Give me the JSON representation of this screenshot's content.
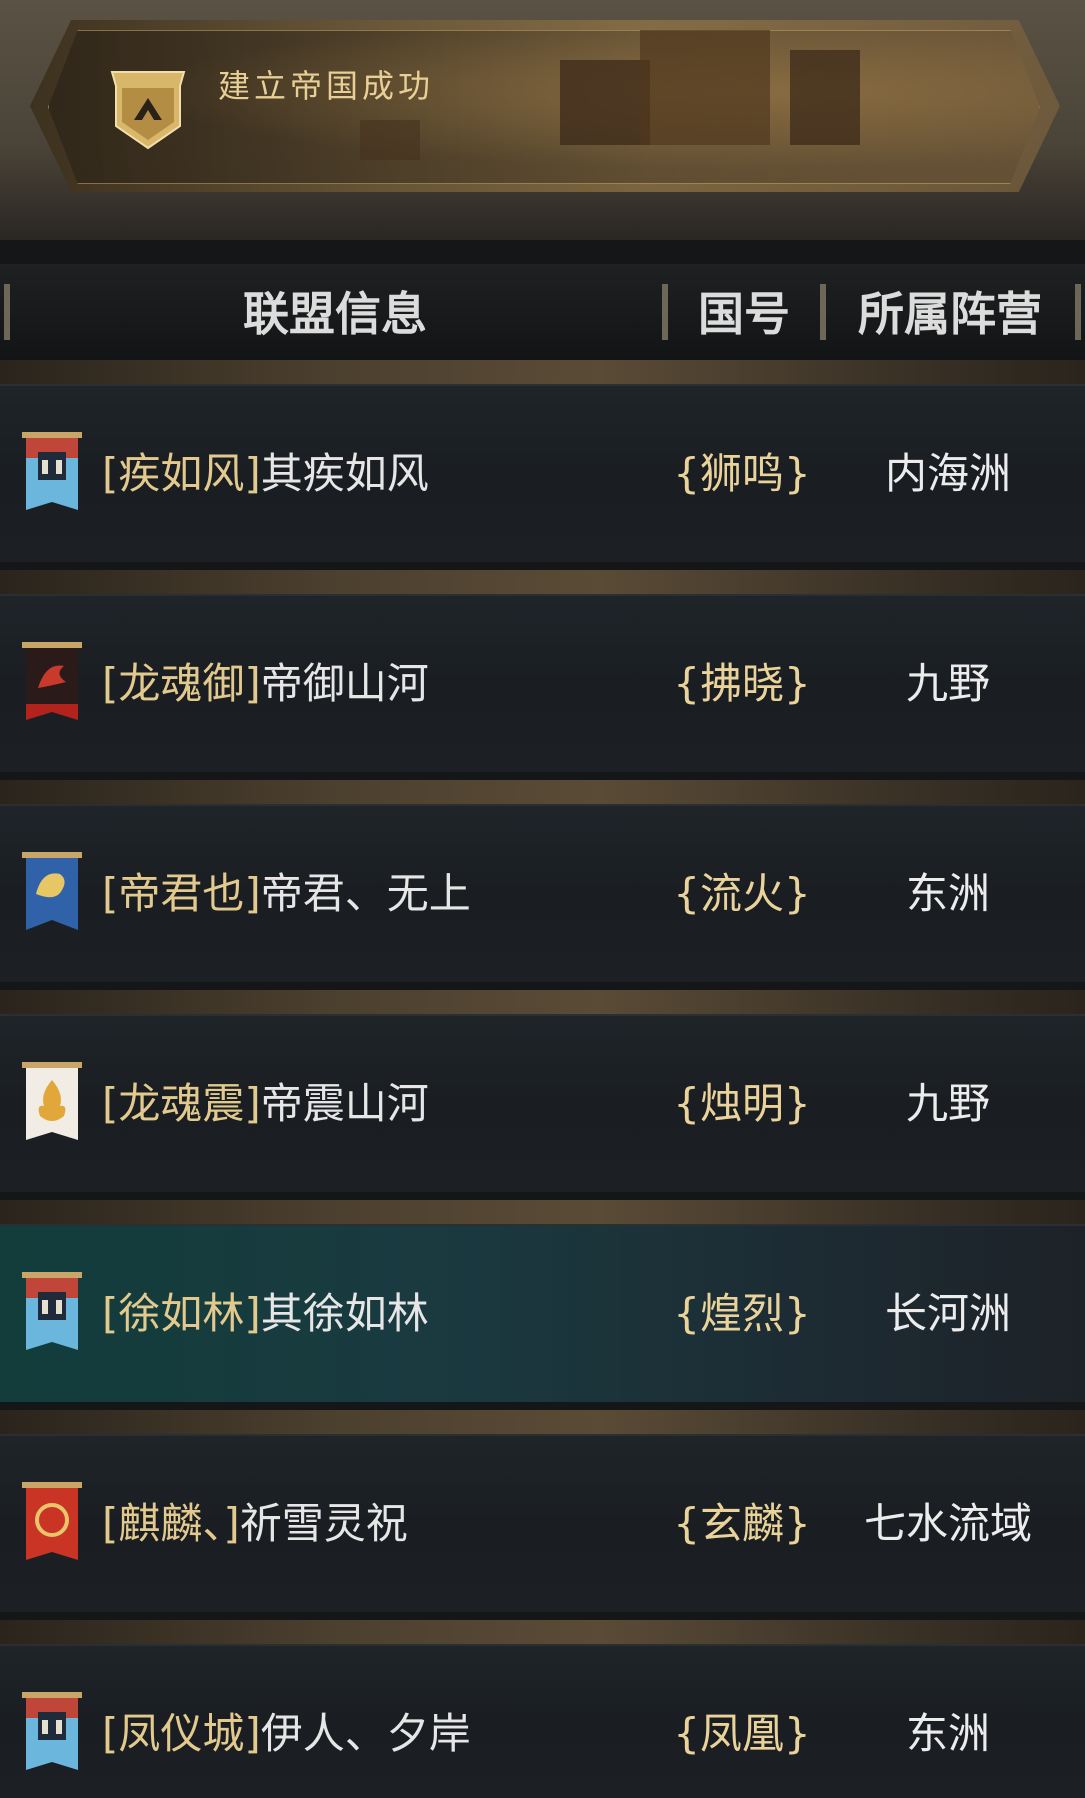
{
  "banner": {
    "title": "建立帝国成功",
    "icon": "emblem-icon"
  },
  "header": {
    "col_alliance": "联盟信息",
    "col_nation": "国号",
    "col_faction": "所属阵营"
  },
  "rows": [
    {
      "tag": "[疾如风]",
      "name": "其疾如风",
      "nation": "{狮鸣}",
      "faction": "内海洲",
      "flag_icon": "tower-flag-icon"
    },
    {
      "tag": "[龙魂御]",
      "name": "帝御山河",
      "nation": "{拂晓}",
      "faction": "九野",
      "flag_icon": "dragon-flag-icon"
    },
    {
      "tag": "[帝君也]",
      "name": "帝君、无上",
      "nation": "{流火}",
      "faction": "东洲",
      "flag_icon": "griffin-flag-icon"
    },
    {
      "tag": "[龙魂震]",
      "name": "帝震山河",
      "nation": "{烛明}",
      "faction": "九野",
      "flag_icon": "flame-flag-icon"
    },
    {
      "tag": "[徐如林]",
      "name": "其徐如林",
      "nation": "{煌烈}",
      "faction": "长河洲",
      "flag_icon": "tower-flag-icon"
    },
    {
      "tag": "[麒麟、]",
      "name": "祈雪灵祝",
      "nation": "{玄麟}",
      "faction": "七水流域",
      "flag_icon": "wreath-flag-icon"
    },
    {
      "tag": "[凤仪城]",
      "name": "伊人、夕岸",
      "nation": "{凤凰}",
      "faction": "东洲",
      "flag_icon": "tower-flag-icon"
    }
  ],
  "colors": {
    "gold_text": "#e2c98d",
    "highlight_row": "#123d3b"
  }
}
